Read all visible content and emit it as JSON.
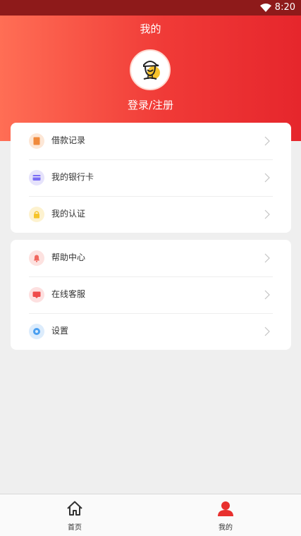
{
  "status_bar": {
    "time": "8:20"
  },
  "header": {
    "title": "我的",
    "login_label": "登录/注册"
  },
  "menu_group_1": [
    {
      "label": "借款记录",
      "icon": "document-icon",
      "color": "#f08a3c",
      "bg": "#fde7d6"
    },
    {
      "label": "我的银行卡",
      "icon": "card-icon",
      "color": "#7a6df5",
      "bg": "#e6e3fb"
    },
    {
      "label": "我的认证",
      "icon": "lock-icon",
      "color": "#f5c42a",
      "bg": "#fdf2cf"
    }
  ],
  "menu_group_2": [
    {
      "label": "帮助中心",
      "icon": "bell-icon",
      "color": "#f0675e",
      "bg": "#fde2e0"
    },
    {
      "label": "在线客服",
      "icon": "chat-icon",
      "color": "#ef4a4a",
      "bg": "#fde0e0"
    },
    {
      "label": "设置",
      "icon": "settings-icon",
      "color": "#4a9ff0",
      "bg": "#dcecfc"
    }
  ],
  "tab_bar": {
    "home_label": "首页",
    "mine_label": "我的",
    "active_tab": "我的",
    "active_color": "#e8302e"
  }
}
